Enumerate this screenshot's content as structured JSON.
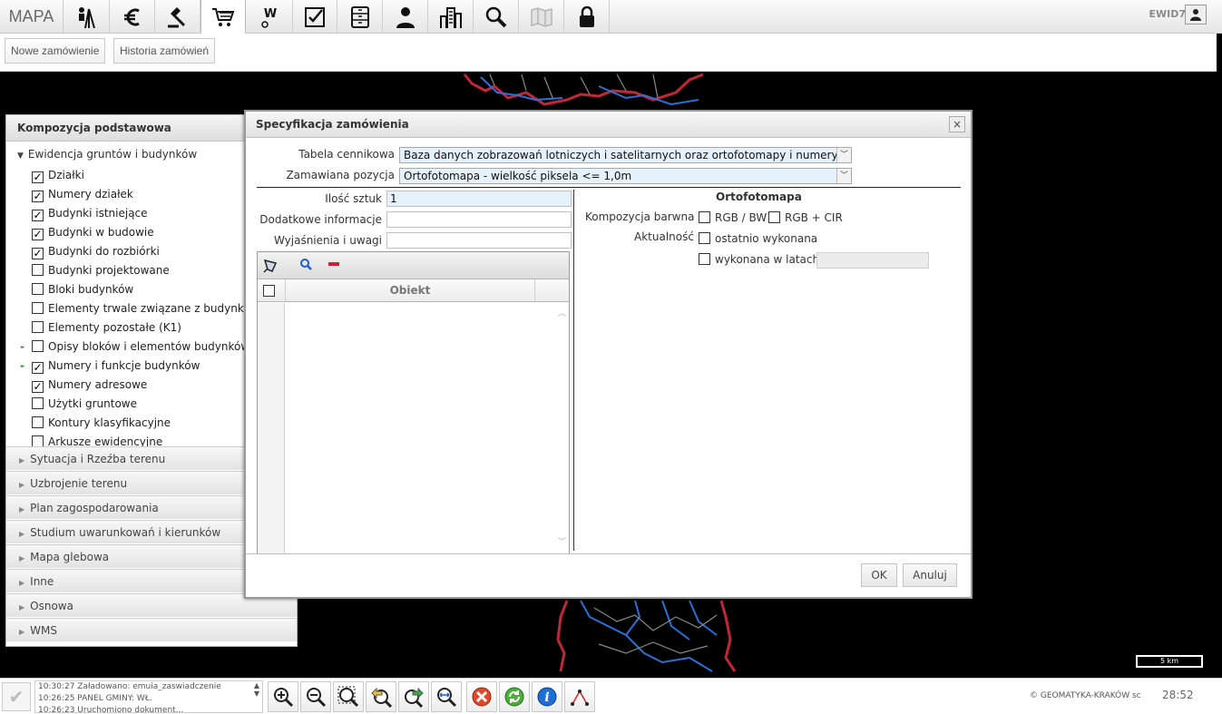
{
  "app": {
    "title": "MAPA",
    "user": "EWID7"
  },
  "toolbar": {
    "icons": [
      "surveyor-icon",
      "euro-icon",
      "gavel-icon",
      "cart-icon",
      "w-icon",
      "checklist-icon",
      "cabinet-icon",
      "person-icon",
      "buildings-icon",
      "magnifier-icon",
      "map-icon",
      "lock-icon"
    ],
    "active": "cart-icon"
  },
  "subtoolbar": {
    "new_order": "Nowe zamówienie",
    "order_history": "Historia zamówień"
  },
  "left_panel": {
    "title": "Kompozycja podstawowa",
    "group": "Ewidencja gruntów i budynków",
    "layers": [
      {
        "label": "Działki",
        "checked": true,
        "marked": false
      },
      {
        "label": "Numery działek",
        "checked": true,
        "marked": false
      },
      {
        "label": "Budynki istniejące",
        "checked": true,
        "marked": false
      },
      {
        "label": "Budynki w budowie",
        "checked": true,
        "marked": false
      },
      {
        "label": "Budynki do rozbiórki",
        "checked": true,
        "marked": false
      },
      {
        "label": "Budynki projektowane",
        "checked": false,
        "marked": false
      },
      {
        "label": "Bloki budynków",
        "checked": false,
        "marked": false
      },
      {
        "label": "Elementy trwale związane z budynkami",
        "checked": false,
        "marked": false
      },
      {
        "label": "Elementy pozostałe (K1)",
        "checked": false,
        "marked": false
      },
      {
        "label": "Opisy bloków i elementów budynków",
        "checked": false,
        "marked": true
      },
      {
        "label": "Numery i funkcje budynków",
        "checked": true,
        "marked": true
      },
      {
        "label": "Numery adresowe",
        "checked": true,
        "marked": false
      },
      {
        "label": "Użytki gruntowe",
        "checked": false,
        "marked": false
      },
      {
        "label": "Kontury klasyfikacyjne",
        "checked": false,
        "marked": false
      },
      {
        "label": "Arkusze ewidencyjne",
        "checked": false,
        "marked": false
      }
    ],
    "sections": [
      "Sytuacja i Rzeźba terenu",
      "Uzbrojenie terenu",
      "Plan zagospodarowania",
      "Studium uwarunkowań i kierunków",
      "Mapa glebowa",
      "Inne",
      "Osnowa",
      "WMS"
    ]
  },
  "dialog": {
    "title": "Specyfikacja zamówienia",
    "close": "×",
    "price_table_label": "Tabela cennikowa",
    "price_table_value": "Baza danych zobrazowań lotniczych i satelitarnych oraz ortofotomapy i numerycznego",
    "position_label": "Zamawiana pozycja",
    "position_value": "Ortofotomapa - wielkość piksela <= 1,0m",
    "qty_label": "Ilość sztuk",
    "qty_value": "1",
    "extra_info_label": "Dodatkowe informacje",
    "extra_info_value": "",
    "notes_label": "Wyjaśnienia i uwagi",
    "notes_value": "",
    "grid_column": "Obiekt",
    "ortho_title": "Ortofotomapa",
    "composition_label": "Kompozycja barwna",
    "rgb_bw": "RGB / BW",
    "rgb_cir": "RGB + CIR",
    "actuality_label": "Aktualność",
    "recently_done": "ostatnio wykonana",
    "done_in_years": "wykonana w latach:",
    "ok": "OK",
    "cancel": "Anuluj"
  },
  "map": {
    "scale": "5 km"
  },
  "status": {
    "log": [
      "10:30:27 Załadowano: emuia_zaswiadczenie",
      "10:26:25 PANEL GMINY: WŁ.",
      "10:26:23 Uruchomiono dokument..."
    ],
    "map_tools": [
      "zoom-in-icon",
      "zoom-out-icon",
      "zoom-window-icon",
      "zoom-previous-icon",
      "zoom-next-icon",
      "zoom-extent-icon",
      "clear-icon",
      "refresh-icon",
      "info-icon",
      "measure-icon"
    ],
    "copyright": "© GEOMATYKA-KRAKÓW sc",
    "clock": "28:52"
  },
  "colors": {
    "accent_input": "#e6f2fb",
    "map_boundary_red": "#c0283a",
    "map_river_blue": "#2e6fd6"
  }
}
